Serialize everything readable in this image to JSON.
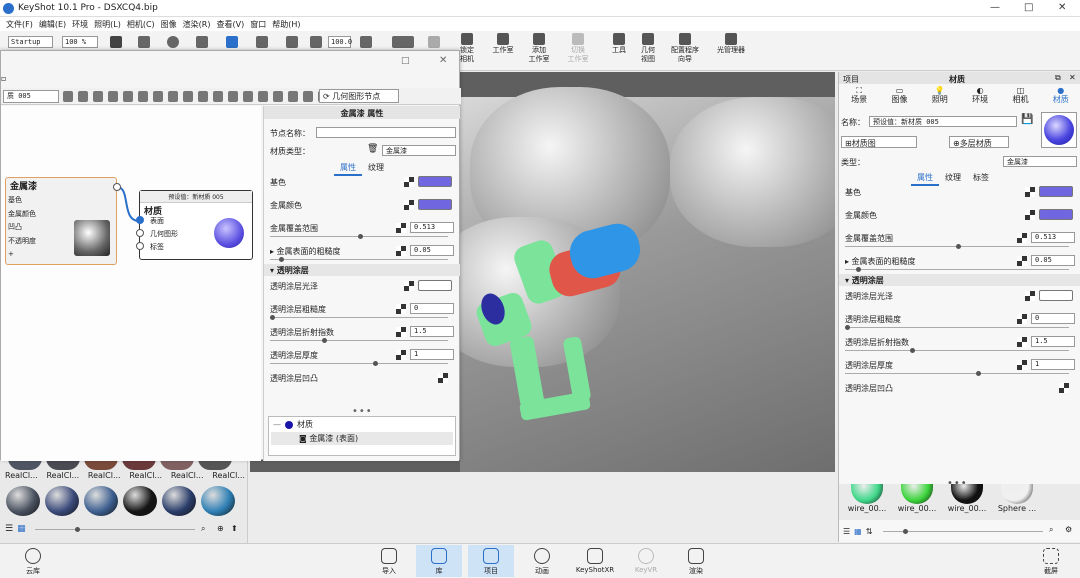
{
  "titlebar": {
    "title": "KeyShot 10.1 Pro  -  DSXCQ4.bip",
    "min": "—",
    "max": "□",
    "close": "✕"
  },
  "menu": [
    "文件(F)",
    "编辑(E)",
    "环境",
    "照明(L)",
    "相机(C)",
    "图像",
    "渲染(R)",
    "查看(V)",
    "窗口",
    "帮助(H)"
  ],
  "toolbar": {
    "startup": "Startup",
    "zoom": "100 %",
    "value": "100.0",
    "buttons": [
      "锁定\n相机",
      "工作室",
      "添加\n工作室",
      "切换\n工作室",
      "工具",
      "几何\n视图",
      "配置程序\n向导",
      "光管理器"
    ]
  },
  "graph_window": {
    "material_field": "质 005",
    "geometry_node_btn": "几何图形节点",
    "node_metal": {
      "title": "金属漆",
      "ports": [
        "基色",
        "金属颜色",
        "凹凸",
        "不透明度",
        "+"
      ]
    },
    "node_material": {
      "header": "预设值：新材质 005",
      "title": "材质",
      "ports": [
        "表面",
        "几何图形",
        "标签"
      ]
    }
  },
  "props": {
    "header": "金属漆 属性",
    "node_name_label": "节点名称：",
    "material_type_label": "材质类型：",
    "material_type": "金属漆",
    "tabs": [
      "属性",
      "纹理"
    ],
    "rows": [
      {
        "label": "基色",
        "kind": "color",
        "color": "#6f66e0"
      },
      {
        "label": "金属颜色",
        "kind": "color",
        "color": "#6f66e0"
      },
      {
        "label": "金属覆盖范围",
        "kind": "value",
        "value": "0.513",
        "pos": 0.51
      },
      {
        "label": "金属表面的粗糙度",
        "kind": "value",
        "value": "0.05",
        "pos": 0.05,
        "expand": true
      }
    ],
    "clearcoat_section": "透明涂层",
    "clearcoat_rows": [
      {
        "label": "透明涂层光泽",
        "kind": "color",
        "color": "#ffffff"
      },
      {
        "label": "透明涂层粗糙度",
        "kind": "value",
        "value": "0",
        "pos": 0.0
      },
      {
        "label": "透明涂层折射指数",
        "kind": "value",
        "value": "1.5",
        "pos": 0.3
      },
      {
        "label": "透明涂层厚度",
        "kind": "value",
        "value": "1",
        "pos": 0.6
      },
      {
        "label": "透明涂层凹凸",
        "kind": "tex"
      }
    ],
    "tree": {
      "root": "材质",
      "child": "金属漆 (表面)"
    }
  },
  "right_panel": {
    "header_left": "项目",
    "header_center": "材质",
    "tabs": [
      "场景",
      "图像",
      "照明",
      "环境",
      "相机",
      "材质"
    ],
    "name_label": "名称：",
    "name_value": "预设值：新材质 005",
    "graph_btn": "材质图",
    "multi_btn": "多层材质",
    "type_label": "类型：",
    "type_value": "金属漆",
    "subtabs": [
      "属性",
      "纹理",
      "标签"
    ],
    "rows": [
      {
        "label": "基色",
        "kind": "color",
        "color": "#6f66e0"
      },
      {
        "label": "金属颜色",
        "kind": "color",
        "color": "#6f66e0"
      },
      {
        "label": "金属覆盖范围",
        "kind": "value",
        "value": "0.513",
        "pos": 0.51
      },
      {
        "label": "金属表面的粗糙度",
        "kind": "value",
        "value": "0.05",
        "pos": 0.05,
        "expand": true
      }
    ],
    "clearcoat_section": "透明涂层",
    "clearcoat_rows": [
      {
        "label": "透明涂层光泽",
        "kind": "color",
        "color": "#ffffff"
      },
      {
        "label": "透明涂层粗糙度",
        "kind": "value",
        "value": "0",
        "pos": 0.0
      },
      {
        "label": "透明涂层折射指数",
        "kind": "value",
        "value": "1.5",
        "pos": 0.3
      },
      {
        "label": "透明涂层厚度",
        "kind": "value",
        "value": "1",
        "pos": 0.6
      },
      {
        "label": "透明涂层凹凸",
        "kind": "tex"
      }
    ],
    "library": [
      {
        "name": "wire_00...",
        "color": "#3fd88a"
      },
      {
        "name": "wire_00...",
        "color": "#3bd43b"
      },
      {
        "name": "wire_00...",
        "color": "#111111"
      },
      {
        "name": "Sphere ...",
        "color": "#f0f0f0"
      }
    ]
  },
  "left_library": {
    "items": [
      {
        "name": "RealCl...",
        "color": "#4a5260"
      },
      {
        "name": "RealCl...",
        "color": "#3a4a7a"
      },
      {
        "name": "RealCl...",
        "color": "#3d5f90"
      },
      {
        "name": "RealCl...",
        "color": "#151515"
      },
      {
        "name": "RealCl...",
        "color": "#2a3d6a"
      },
      {
        "name": "RealCl...",
        "color": "#2e7fb5"
      }
    ]
  },
  "bottombar": {
    "library_left": "云库",
    "items": [
      "导入",
      "库",
      "项目",
      "动画",
      "KeyShotXR",
      "KeyVR",
      "渲染"
    ],
    "right": "截屏"
  }
}
